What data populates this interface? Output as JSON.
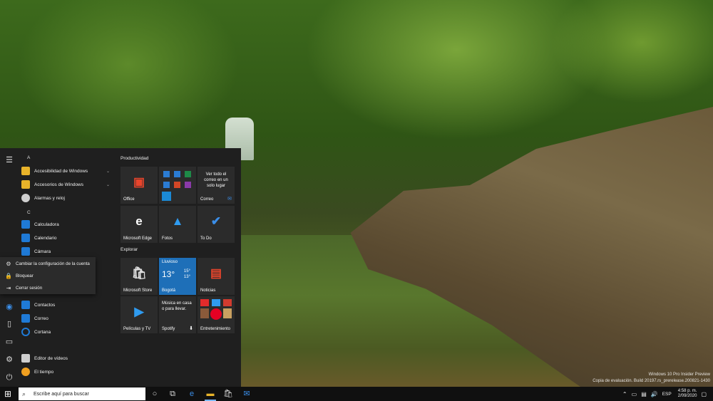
{
  "wallpaper": {
    "watermark_line1": "Windows 10 Pro Insider Preview",
    "watermark_line2": "Copia de evaluación. Build 20197.rs_prerelease.200821-1430"
  },
  "start_menu": {
    "rail": [
      "hamburger-icon",
      "user-icon",
      "document-icon",
      "pictures-icon",
      "settings-icon",
      "power-icon"
    ],
    "letters": {
      "a": "A",
      "c": "C"
    },
    "apps": [
      {
        "label": "Accesibilidad de Windows",
        "icon": "folder-icon",
        "color": "#e8b32a",
        "expandable": true
      },
      {
        "label": "Accesorios de Windows",
        "icon": "folder-icon",
        "color": "#e8b32a",
        "expandable": true
      },
      {
        "label": "Alarmas y reloj",
        "icon": "clock-icon",
        "color": "#cfcfcf",
        "expandable": false
      },
      {
        "label": "Calculadora",
        "icon": "calculator-icon",
        "color": "#1f7ad6",
        "expandable": false
      },
      {
        "label": "Calendario",
        "icon": "calendar-icon",
        "color": "#1f7ad6",
        "expandable": false
      },
      {
        "label": "Cámara",
        "icon": "camera-icon",
        "color": "#1f7ad6",
        "expandable": false
      },
      {
        "label": "Contactos",
        "icon": "contacts-icon",
        "color": "#1f7ad6",
        "expandable": false
      },
      {
        "label": "Correo",
        "icon": "mail-icon",
        "color": "#1f7ad6",
        "expandable": false
      },
      {
        "label": "Cortana",
        "icon": "cortana-icon",
        "color": "#1f7ad6",
        "expandable": false
      },
      {
        "label": "Editor de vídeos",
        "icon": "video-editor-icon",
        "color": "#cfcfcf",
        "expandable": false
      },
      {
        "label": "El tiempo",
        "icon": "weather-icon",
        "color": "#f0a020",
        "expandable": false
      }
    ],
    "power_menu": [
      {
        "label": "Cambiar la configuración de la cuenta",
        "icon": "account-settings-icon"
      },
      {
        "label": "Bloquear",
        "icon": "lock-icon"
      },
      {
        "label": "Cerrar sesión",
        "icon": "sign-out-icon"
      }
    ],
    "groups": {
      "productividad": "Productividad",
      "explorar": "Explorar"
    },
    "tiles": {
      "office": "Office",
      "correo_promo": "Ver todo el correo en un solo lugar",
      "correo": "Correo",
      "edge": "Microsoft Edge",
      "fotos": "Fotos",
      "todo": "To Do",
      "store": "Microsoft Store",
      "weather_condition": "Lluvioso",
      "weather_temp": "13°",
      "weather_high": "15°",
      "weather_low": "13°",
      "weather_city": "Bogotá",
      "noticias": "Noticias",
      "peliculas": "Películas y TV",
      "spotify_promo": "Música en casa o para llevar.",
      "spotify": "Spotify",
      "entretenimiento": "Entretenimiento"
    }
  },
  "taskbar": {
    "search_placeholder": "Escribe aquí para buscar",
    "language": "ESP",
    "time": "4:58 p. m.",
    "date": "2/09/2020"
  }
}
